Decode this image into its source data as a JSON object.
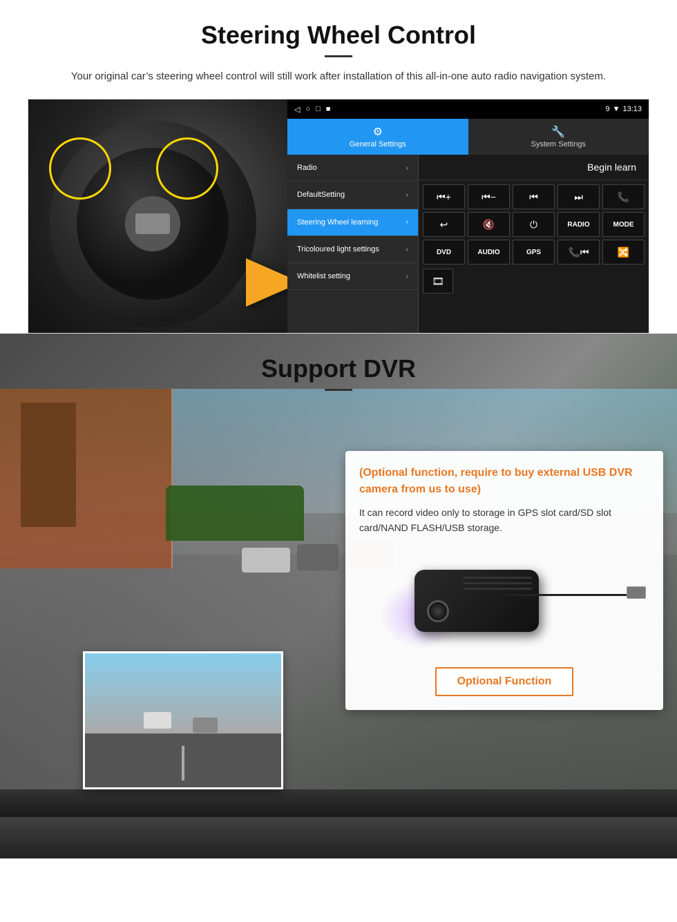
{
  "page": {
    "steering": {
      "title": "Steering Wheel Control",
      "subtitle": "Your original car’s steering wheel control will still work after installation of this all-in-one auto radio navigation system.",
      "android": {
        "statusbar": {
          "icons_left": [
            "◁",
            "○",
            "□",
            "■"
          ],
          "time": "13:13",
          "icons_right": [
            "9",
            "▼"
          ]
        },
        "tabs": [
          {
            "label": "General Settings",
            "active": true,
            "icon": "⚙"
          },
          {
            "label": "System Settings",
            "active": false,
            "icon": "🔧"
          }
        ],
        "menu_items": [
          {
            "label": "Radio",
            "active": false
          },
          {
            "label": "DefaultSetting",
            "active": false
          },
          {
            "label": "Steering Wheel learning",
            "active": true
          },
          {
            "label": "Tricoloured light settings",
            "active": false
          },
          {
            "label": "Whitelist setting",
            "active": false
          }
        ],
        "begin_learn": "Begin learn",
        "ctrl_buttons": [
          "⏮+",
          "⏮-",
          "⏮",
          "⏭",
          "📞",
          "↩",
          "🔇",
          "⏻",
          "RADIO",
          "MODE",
          "DVD",
          "AUDIO",
          "GPS",
          "📞⏮",
          "🔀"
        ],
        "extra_btn": "🎞"
      }
    },
    "dvr": {
      "title": "Support DVR",
      "info_title": "(Optional function, require to buy external USB DVR camera from us to use)",
      "info_body": "It can record video only to storage in GPS slot card/SD slot card/NAND FLASH/USB storage.",
      "optional_btn_label": "Optional Function"
    }
  }
}
